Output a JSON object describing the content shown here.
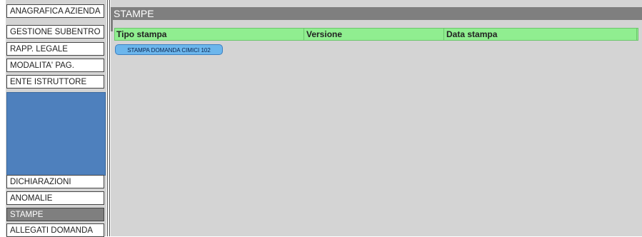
{
  "sidebar": {
    "items": [
      {
        "label": "ANAGRAFICA AZIENDA"
      },
      {
        "label": "GESTIONE SUBENTRO"
      },
      {
        "label": "RAPP. LEGALE"
      },
      {
        "label": "MODALITA' PAG."
      },
      {
        "label": "ENTE ISTRUTTORE"
      },
      {
        "label": "DICHIARAZIONI"
      },
      {
        "label": "ANOMALIE"
      },
      {
        "label": "STAMPE",
        "active": true
      },
      {
        "label": "ALLEGATI DOMANDA"
      }
    ]
  },
  "main": {
    "title": "STAMPE",
    "table": {
      "columns": [
        "Tipo stampa",
        "Versione",
        "Data stampa"
      ]
    },
    "print_button_label": "STAMPA DOMANDA CIMICI 102"
  },
  "colors": {
    "header_green": "#90ee90",
    "active_gray": "#7f7f7f",
    "button_blue": "#6cb6ec",
    "block_blue": "#4e80bd"
  }
}
